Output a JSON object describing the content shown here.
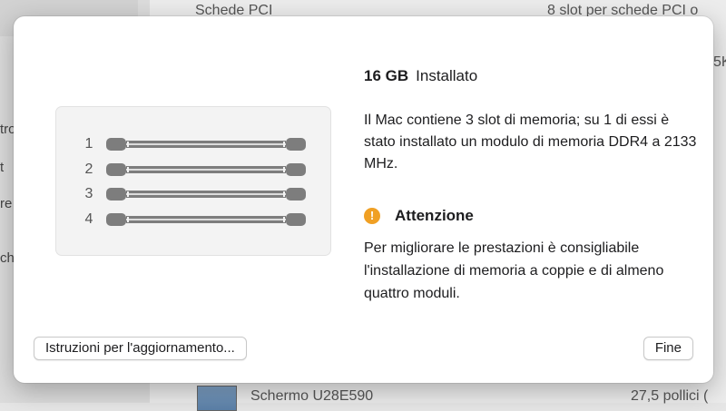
{
  "background": {
    "rows": [
      {
        "label": "Schede PCI",
        "value": "8 slot per schede PCI o"
      },
      {
        "label": "Schermo U28E590",
        "value": "27,5 pollici ("
      }
    ],
    "sidebar_fragments": [
      "tro",
      "t",
      "re",
      "ch"
    ],
    "right_fragment": "5K"
  },
  "memory_sheet": {
    "capacity_value": "16 GB",
    "capacity_label": "Installato",
    "description": "Il Mac contiene 3 slot di memoria; su 1 di essi è stato installato un modulo di memoria DDR4 a 2133 MHz.",
    "slots": [
      {
        "number": "1"
      },
      {
        "number": "2"
      },
      {
        "number": "3"
      },
      {
        "number": "4"
      }
    ],
    "warning": {
      "icon": "exclamation-circle-icon",
      "icon_glyph": "!",
      "title": "Attenzione",
      "text": "Per migliorare le prestazioni è consigliabile l'installazione di memoria a coppie e di almeno quattro moduli."
    },
    "buttons": {
      "upgrade": "Istruzioni per l'aggiornamento...",
      "done": "Fine"
    }
  },
  "colors": {
    "warning": "#f0a024",
    "slot": "#7d7d7d"
  }
}
